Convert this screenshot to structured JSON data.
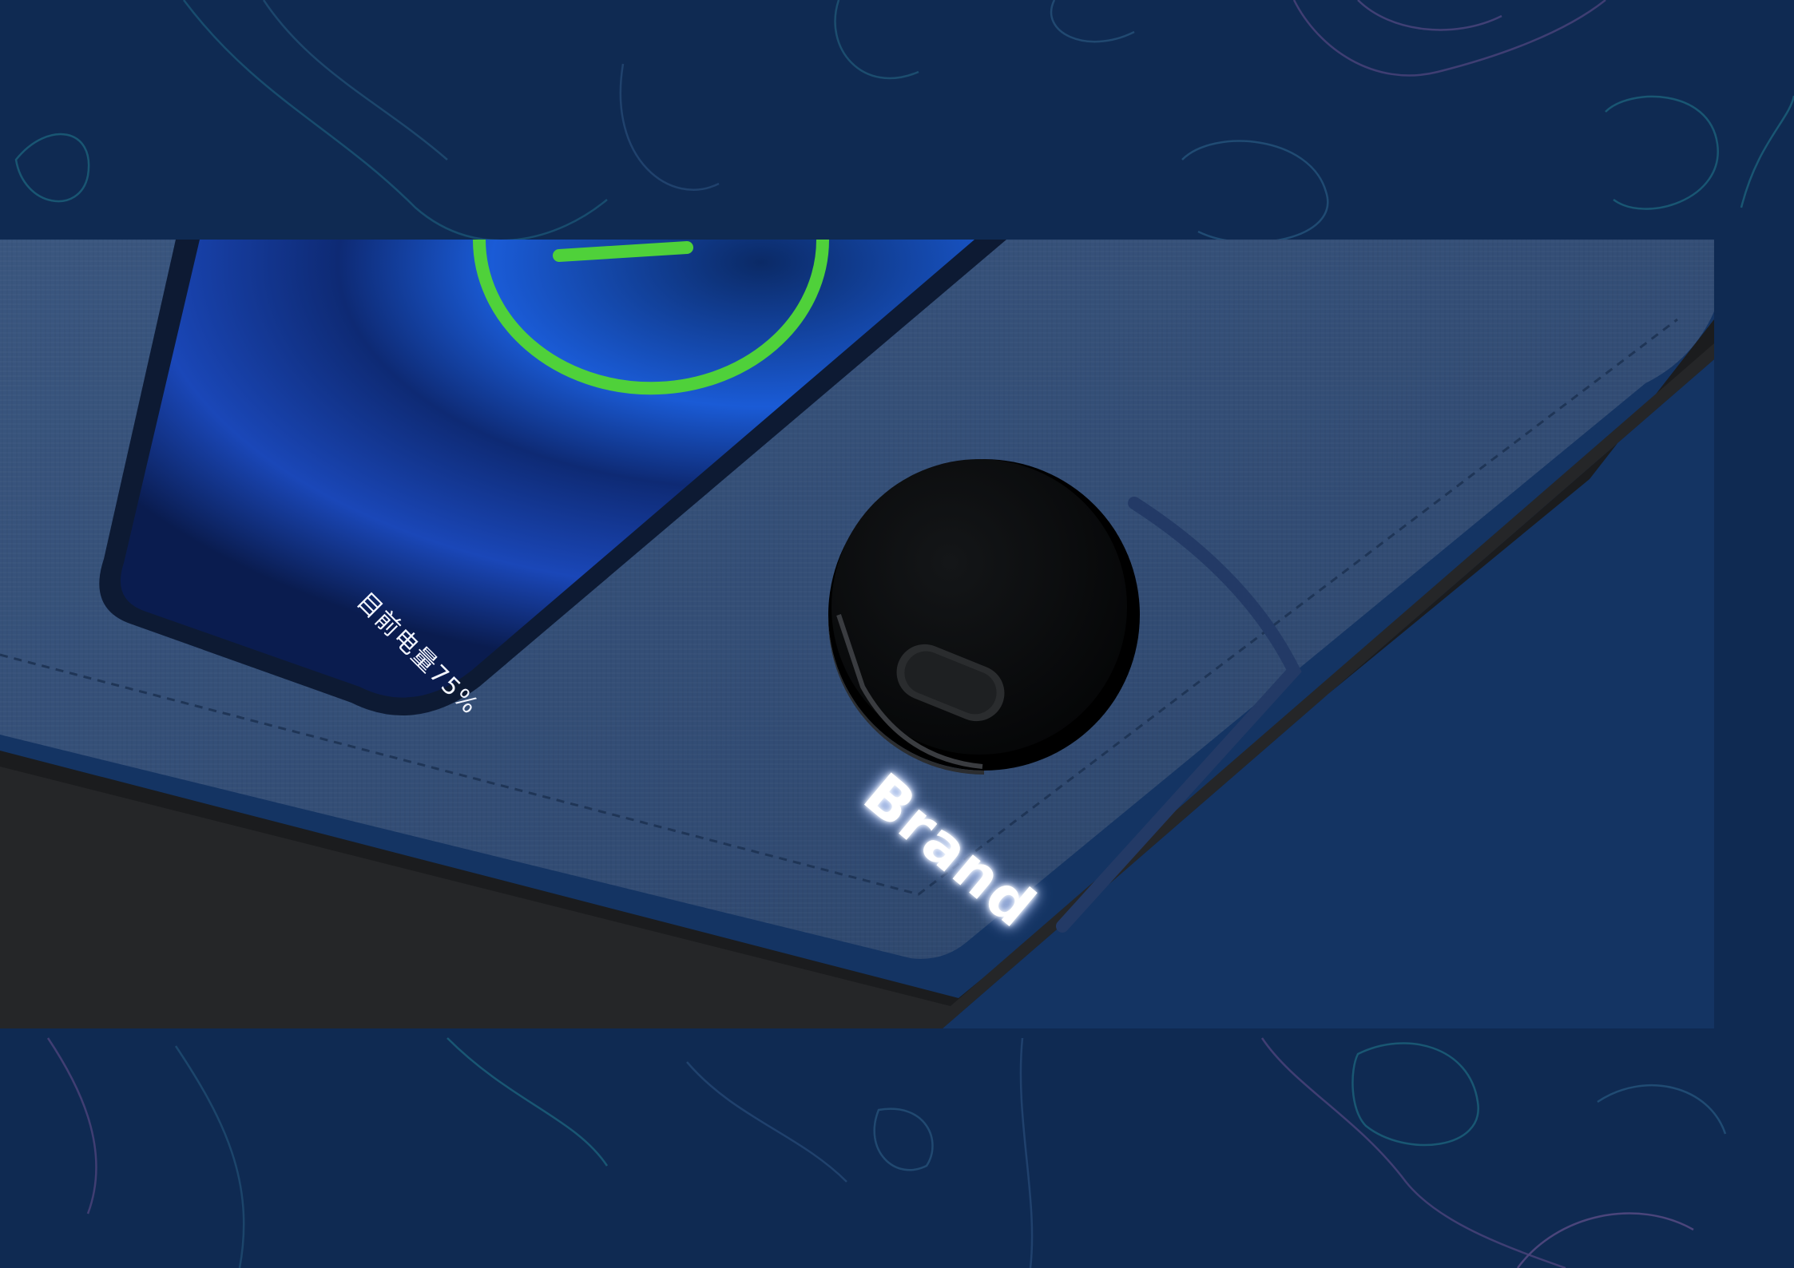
{
  "scene": {
    "phone_screen": {
      "battery_label": "目前电量75%",
      "battery_level_percent": 75
    },
    "logo_badge": {
      "logo_text": "Brand"
    }
  },
  "colors": {
    "background": "#0f2a52",
    "topo_line_teal": "#1f6f86",
    "topo_line_purple": "#5a4a86",
    "fabric": "#34507a",
    "charging_ring": "#4fd13a"
  }
}
